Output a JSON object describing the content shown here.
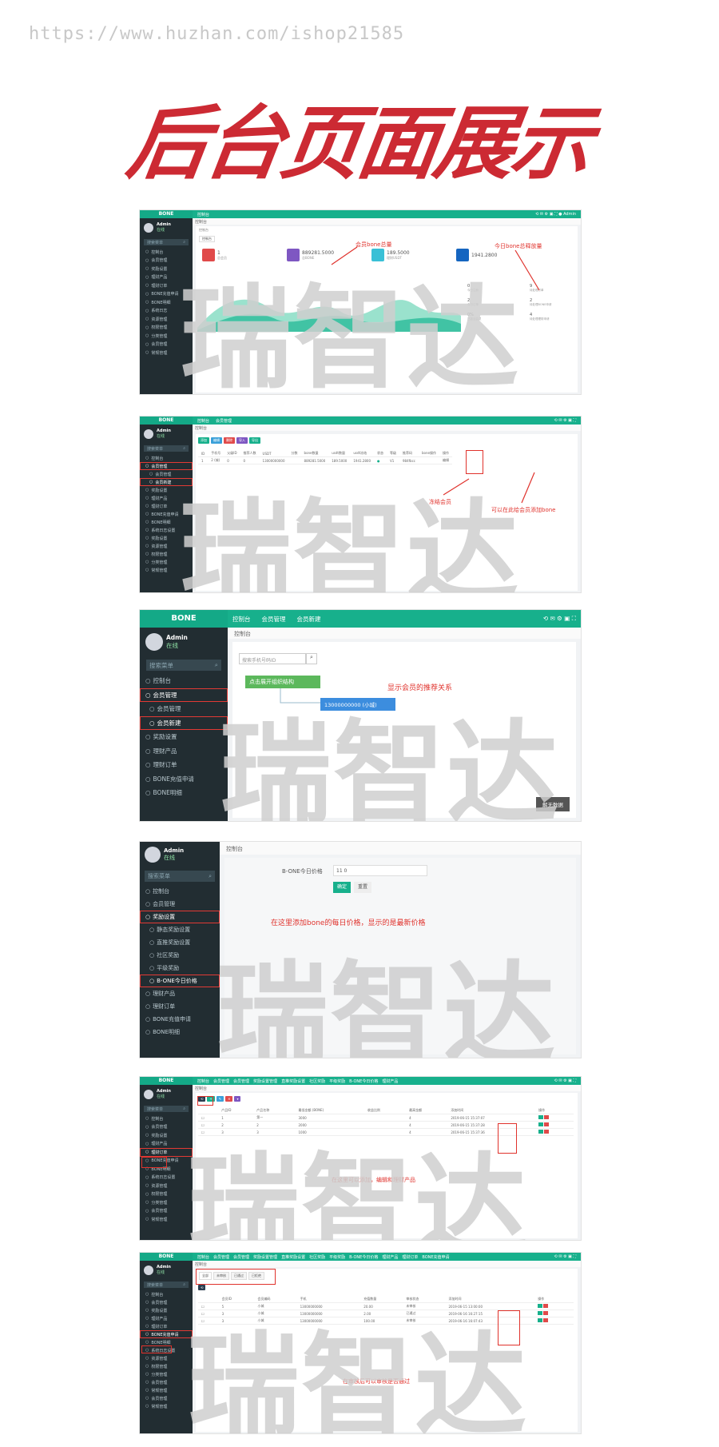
{
  "watermark_url": "https://www.huzhan.com/ishop21585",
  "headline": "后台页面展示",
  "watermark_brand": "瑞智达",
  "brand": "BONE",
  "user": {
    "name": "Admin",
    "status": "在线"
  },
  "search_placeholder": "搜索菜单",
  "colors": {
    "green": "#17b08c",
    "sidebar": "#222d32",
    "red": "#cc2a33",
    "annot": "#e0322c"
  },
  "shot1": {
    "tab": "控制台",
    "crumb": "控制台",
    "menu": [
      "控制台",
      "会员管理",
      "奖励设置",
      "理财产品",
      "理财订单",
      "BONE充值申请",
      "BONE明细",
      "系统日志",
      "资源管理",
      "权限管理",
      "分类管理",
      "会员管理",
      "常规管理"
    ],
    "stats": [
      {
        "value": "1",
        "label": "总会员",
        "color": "#e04a4a"
      },
      {
        "value": "889281.5000",
        "label": "总BONE",
        "color": "#7e57c2"
      },
      {
        "value": "189.5000",
        "label": "理财USDT",
        "color": "#39c0d6"
      },
      {
        "value": "1941.2800",
        "label": "",
        "color": "#1565c0"
      }
    ],
    "side_stats": [
      {
        "value": "0",
        "label": "今日注册"
      },
      {
        "value": "2",
        "label": "今日订单"
      },
      {
        "value": "0%",
        "label": "已激活会员"
      },
      {
        "value": "9",
        "label": "待处理订单"
      },
      {
        "value": "2",
        "label": "待处理BONE申请"
      },
      {
        "value": "4",
        "label": "待处理理财申请"
      }
    ],
    "note1": "会员bone总量",
    "note2": "今日bone总释放量"
  },
  "shot2": {
    "tabs": [
      "控制台",
      "会员管理"
    ],
    "crumb": "控制台",
    "menu": [
      "控制台",
      "会员管理",
      "会员管理",
      "会员新建",
      "奖励设置",
      "理财产品",
      "理财订单",
      "BONE充值申请",
      "BONE明细",
      "系统日志设置",
      "奖励设置",
      "资源管理",
      "权限管理",
      "分类管理",
      "常规管理"
    ],
    "buttons": [
      {
        "label": "添加",
        "color": "#17b08c"
      },
      {
        "label": "编辑",
        "color": "#3aa0d9"
      },
      {
        "label": "删除",
        "color": "#e04a4a"
      },
      {
        "label": "导入",
        "color": "#7e57c2"
      },
      {
        "label": "导出",
        "color": "#17b08c"
      }
    ],
    "headers": [
      "ID",
      "手机号",
      "父级ID",
      "推荐人数",
      "USDT",
      "分数",
      "bone数量",
      "usdt数量",
      "usdt冻结",
      "状态",
      "等级",
      "推荐码",
      "bone操作",
      "操作"
    ],
    "row": [
      "1",
      "2 (城)",
      "0",
      "0",
      "13000000000",
      "",
      "889281.5000",
      "189.5000",
      "1941.2800",
      "",
      "V1",
      "984fbcc",
      "",
      "编辑"
    ],
    "note1": "冻结会员",
    "note2": "可以在此给会员添加bone"
  },
  "shot3": {
    "tabs": [
      "控制台",
      "会员管理",
      "会员新建"
    ],
    "crumb": "控制台",
    "menu": [
      "控制台",
      "会员管理",
      "会员管理",
      "会员新建",
      "奖励设置",
      "理财产品",
      "理财订单",
      "BONE充值申请",
      "BONE明细"
    ],
    "search_placeholder": "搜索手机号码ID",
    "expand_btn": "点击展开组织结构",
    "node": "13000000000 (小城)",
    "note": "显示会员的推荐关系",
    "tooltip": "解无数据"
  },
  "shot4": {
    "crumb": "控制台",
    "menu": [
      "控制台",
      "会员管理",
      "奖励设置",
      "静态奖励设置",
      "直推奖励设置",
      "社区奖励",
      "平级奖励",
      "B-ONE今日价格",
      "理财产品",
      "理财订单",
      "BONE充值申请",
      "BONE明细"
    ],
    "field_label": "B-ONE今日价格",
    "field_value": "11 0",
    "ok": "确定",
    "reset": "重置",
    "note": "在这里添加bone的每日价格，显示的是最新价格"
  },
  "shot5": {
    "tabs": [
      "控制台",
      "会员管理",
      "会员管理",
      "奖励设置管理",
      "直推奖励设置",
      "社区奖励",
      "平级奖励",
      "B-ONE今日价格",
      "理财产品"
    ],
    "crumb": "控制台",
    "menu": [
      "控制台",
      "会员管理",
      "奖励设置",
      "理财产品",
      "理财订单",
      "BONE充值申请",
      "BONE明细",
      "系统日志设置",
      "资源管理",
      "权限管理",
      "分类管理",
      "会员管理",
      "常规管理"
    ],
    "headers": [
      "产品ID",
      "产品名称",
      "最低金额 (BONE)",
      "收益比例",
      "最高金额",
      "添加时间",
      "操作"
    ],
    "rows": [
      [
        "1",
        "第一",
        "3000",
        "",
        "4",
        "2019-06-15 15:37:07"
      ],
      [
        "2",
        "2",
        "2000",
        "",
        "4",
        "2019-06-15 15:37:28"
      ],
      [
        "3",
        "3",
        "1000",
        "",
        "4",
        "2019-06-15 15:37:36"
      ]
    ],
    "note": "在这里可以添加，编辑和理财产品"
  },
  "shot6": {
    "tabs": [
      "控制台",
      "会员管理",
      "会员管理",
      "奖励设置管理",
      "直推奖励设置",
      "社区奖励",
      "平级奖励",
      "B-ONE今日价格",
      "理财产品",
      "理财订单",
      "BONE充值申请"
    ],
    "crumb": "控制台",
    "menu": [
      "控制台",
      "会员管理",
      "奖励设置",
      "理财产品",
      "理财订单",
      "BONE充值申请",
      "BONE明细",
      "系统日志设置",
      "资源管理",
      "权限管理",
      "分类管理",
      "会员管理",
      "常规管理",
      "会员管理",
      "常规管理"
    ],
    "filter_tabs": [
      "全部",
      "未审核",
      "已通过",
      "已拒绝"
    ],
    "headers": [
      "会员ID",
      "会员编码",
      "手机",
      "充值数量",
      "审核状态",
      "添加时间",
      "操作"
    ],
    "rows": [
      [
        "5",
        "小城",
        "13000000000",
        "20.00",
        "未审核",
        "2019-06-15 13:00:00"
      ],
      [
        "3",
        "小城",
        "13000000000",
        "2.00",
        "已通过",
        "2019-06-16 16:27:15"
      ],
      [
        "3",
        "小城",
        "13000000000",
        "100.00",
        "未审核",
        "2019-06-16 16:07:43"
      ]
    ],
    "note": "在审核后可以审核是否通过"
  }
}
